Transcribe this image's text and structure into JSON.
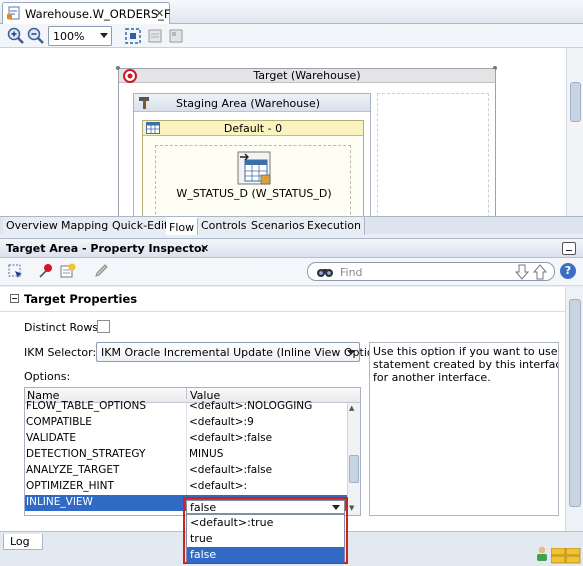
{
  "editor": {
    "tab_title": "Warehouse.W_ORDERS_F",
    "zoom": "100%"
  },
  "diagram": {
    "target_title": "Target (Warehouse)",
    "staging_title": "Staging Area (Warehouse)",
    "default_title": "Default - 0",
    "node_label": "W_STATUS_D (W_STATUS_D)"
  },
  "editor_tabs": [
    "Overview",
    "Mapping",
    "Quick-Edit",
    "Flow",
    "Controls",
    "Scenarios",
    "Execution"
  ],
  "editor_tabs_active": "Flow",
  "inspector": {
    "title": "Target Area - Property Inspector",
    "find_placeholder": "Find",
    "section_title": "Target Properties",
    "distinct_label": "Distinct Rows:",
    "distinct_checked": false,
    "ikm_label": "IKM Selector:",
    "ikm_value": "IKM Oracle Incremental Update (Inline View Option)",
    "options_label": "Options:",
    "description": [
      "Use this option if you want to use the s",
      "statement created by this interface as",
      "for another interface."
    ],
    "table": {
      "col_name": "Name",
      "col_value": "Value",
      "rows": [
        {
          "name": "FLOW_TABLE_OPTIONS",
          "value": "<default>:NOLOGGING"
        },
        {
          "name": "COMPATIBLE",
          "value": "<default>:9"
        },
        {
          "name": "VALIDATE",
          "value": "<default>:false"
        },
        {
          "name": "DETECTION_STRATEGY",
          "value": "MINUS"
        },
        {
          "name": "ANALYZE_TARGET",
          "value": "<default>:false"
        },
        {
          "name": "OPTIMIZER_HINT",
          "value": "<default>:"
        },
        {
          "name": "INLINE_VIEW",
          "value": ""
        }
      ]
    },
    "inline_view_dropdown": {
      "selected": "false",
      "options": [
        "<default>:true",
        "true",
        "false"
      ]
    }
  },
  "statusbar": {
    "log_tab": "Log"
  },
  "colors": {
    "selection": "#316ac5",
    "highlight_frame": "#d02020",
    "target_icon": "#d0182a"
  },
  "icons": [
    "document-tab-icon",
    "zoom-in-icon",
    "zoom-out-icon",
    "fit-icon",
    "pushpin-icon",
    "binoculars-icon",
    "help-icon",
    "target-icon",
    "staging-hammer-icon",
    "table-icon",
    "datastore-icon"
  ]
}
